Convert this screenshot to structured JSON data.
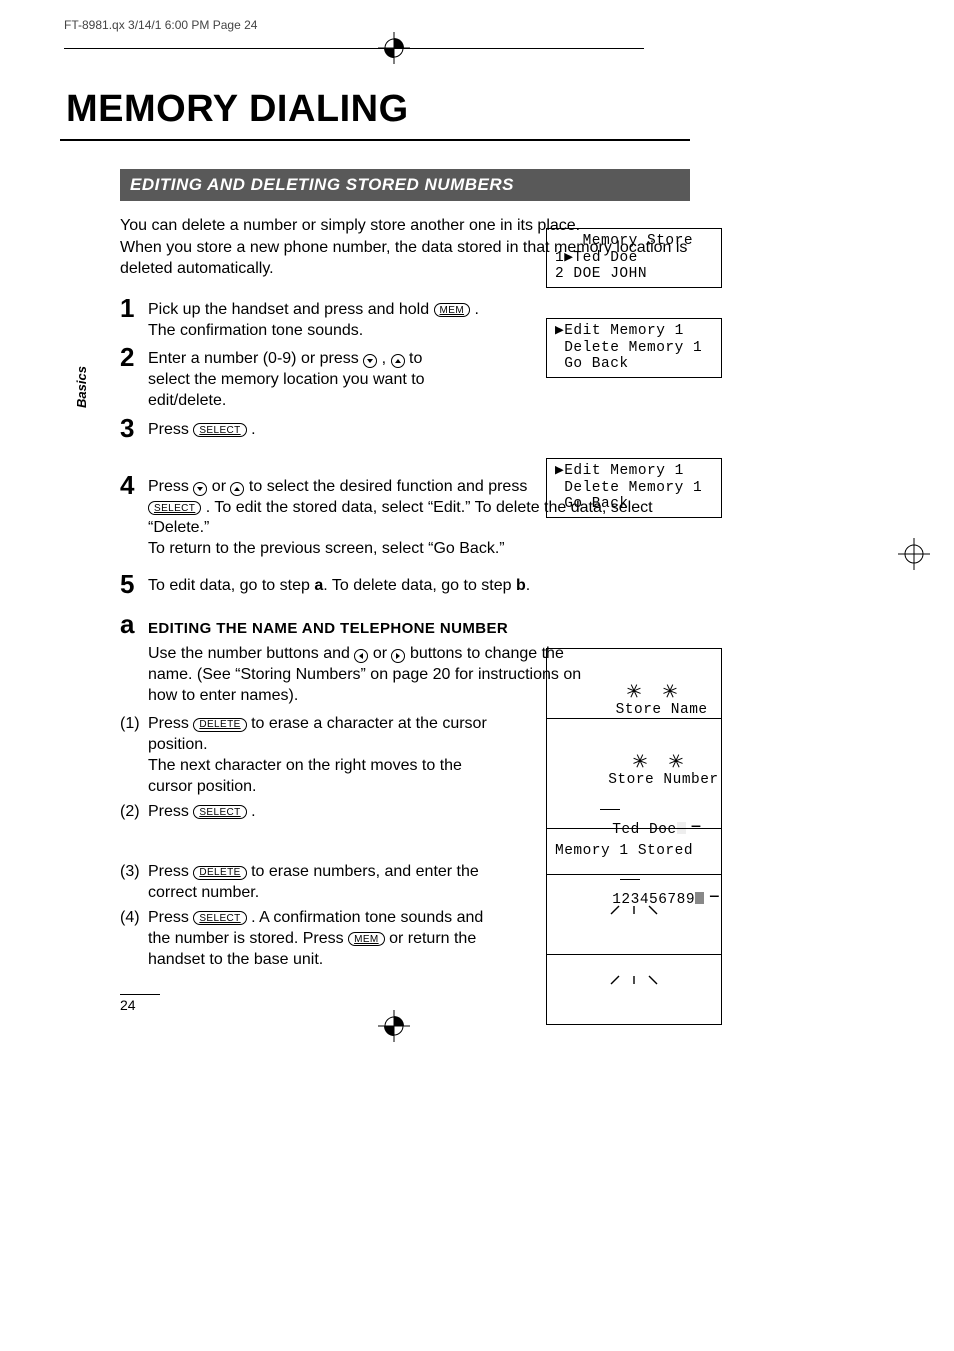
{
  "slug": "FT-8981.qx  3/14/1  6:00 PM  Page 24",
  "title": "MEMORY DIALING",
  "section_bar": "EDITING AND DELETING STORED NUMBERS",
  "sidetab": "Basics",
  "intro": "You can delete a number or simply store another one in its place.\nWhen you store a new phone number, the data stored in that memory location is deleted automatically.",
  "keys": {
    "mem": "MEM",
    "select": "SELECT",
    "delete": "DELETE"
  },
  "steps": {
    "s1": {
      "n": "1",
      "pre": "Pick up the handset and press and hold ",
      "post": " .  The confirmation tone sounds."
    },
    "s2": {
      "n": "2",
      "pre": "Enter a number (0-9) or press ",
      "mid": " , ",
      "post": "  to select the memory location you want to edit/delete."
    },
    "s3": {
      "n": "3",
      "pre": "Press ",
      "post": " ."
    },
    "s4": {
      "n": "4",
      "pre": "Press ",
      "mid1": "  or ",
      "mid2": "  to select the desired function and press ",
      "post1": " .  To edit the stored data, select “Edit.”  To delete the data, select “Delete.”",
      "post2": "To return to the previous screen, select “Go Back.”"
    },
    "s5": {
      "n": "5",
      "pre": "To edit data, go to step ",
      "a": "a",
      "mid": ".  To delete data, go to step ",
      "b": "b",
      "post": "."
    }
  },
  "sub": {
    "letter": "a",
    "title": "EDITING THE NAME AND TELEPHONE NUMBER",
    "intro_pre": "Use the number buttons and ",
    "intro_mid": "  or ",
    "intro_post": "  buttons to change the name.  (See “Storing Numbers” on page 20 for instructions on how to enter names).",
    "p1": {
      "n": "(1)",
      "pre": "Press ",
      "post": "  to erase a character at the cursor position.",
      "line2": "The next character on the right moves to the cursor position."
    },
    "p2": {
      "n": "(2)",
      "pre": "Press ",
      "post": " ."
    },
    "p3": {
      "n": "(3)",
      "pre": "Press ",
      "post": "  to erase numbers, and enter the correct number."
    },
    "p4": {
      "n": "(4)",
      "pre": "Press ",
      "mid": " .  A confirmation tone sounds and the number is stored.  Press ",
      "post": "  or return the handset to the base unit."
    }
  },
  "lcd": {
    "memstore": "   Memory Store\n1▶Ted Doe\n2 DOE JOHN",
    "menu1": "▶Edit Memory 1\n Delete Memory 1\n Go Back",
    "menu2": "▶Edit Memory 1\n Delete Memory 1\n Go Back",
    "storename_title": "Store Name",
    "storename_val": "Ted Doe",
    "storenum_title": "Store Number",
    "storenum_val": "123456789",
    "stored": "Memory 1 Stored"
  },
  "pagenum": "24"
}
